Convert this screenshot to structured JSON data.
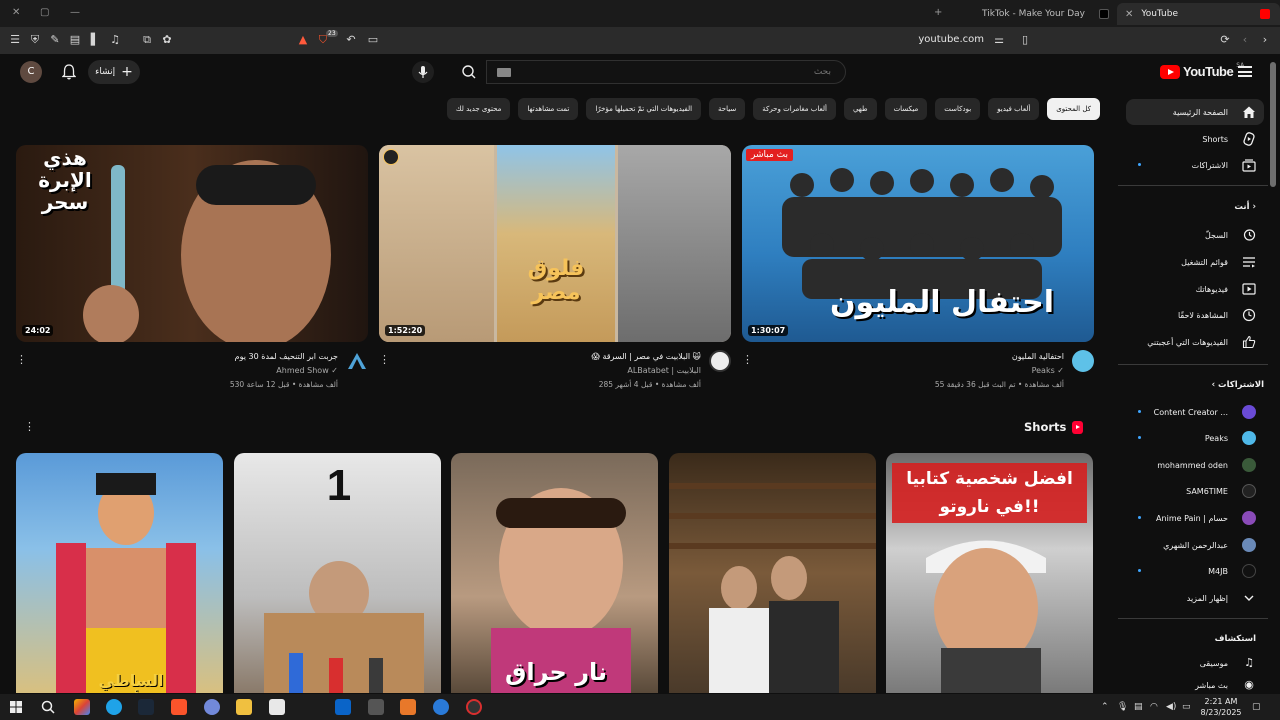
{
  "browser": {
    "tabs": [
      {
        "title": "TikTok - Make Your Day",
        "active": false
      },
      {
        "title": "YouTube",
        "active": true
      }
    ],
    "url": "youtube.com",
    "shield_count": "23"
  },
  "header": {
    "avatar_letter": "C",
    "create_label": "إنشاء",
    "search_placeholder": "بحث",
    "logo_text": "YouTube",
    "logo_region": "SA"
  },
  "chips": [
    {
      "label": "كل المحتوى",
      "active": true
    },
    {
      "label": "ألعاب فيديو"
    },
    {
      "label": "بودكاست"
    },
    {
      "label": "ميكسات"
    },
    {
      "label": "طهي"
    },
    {
      "label": "ألعاب مغامرات وحركة"
    },
    {
      "label": "سياحة"
    },
    {
      "label": "الفيديوهات التي تمّ تحميلها مؤخرًا"
    },
    {
      "label": "تمت مشاهدتها"
    },
    {
      "label": "محتوى جديد لك"
    }
  ],
  "videos": [
    {
      "title": "احتفالية المليون",
      "channel": "Peaks ✓",
      "stats": "55 ألف مشاهدة • تم البث قبل 36 دقيقة",
      "duration": "1:30:07",
      "thumb_text": "احتفال المليون",
      "live_badge": "بث مباشر"
    },
    {
      "title": "😱 البلابيت في مصر | السرقة 🙀",
      "channel": "ALBatabet | البلابيت",
      "stats": "285 ألف مشاهدة • قبل 4 أشهر",
      "duration": "1:52:20",
      "thumb_text": "فلوق مصر"
    },
    {
      "title": "جربت ابر التنحيف لمدة 30 يوم",
      "channel": "Ahmed Show ✓",
      "stats": "530 ألف مشاهدة • قبل 12 ساعة",
      "duration": "24:02",
      "thumb_text": "هذي الإبرة سحر"
    }
  ],
  "shorts": {
    "title": "Shorts",
    "items": [
      {
        "thumb_text": "افضل شخصية كتابيا في ناروتو!!"
      },
      {
        "thumb_text": ""
      },
      {
        "thumb_text": "نار حراق"
      },
      {
        "thumb_text": "1"
      },
      {
        "thumb_text": "الساطي الأول"
      }
    ]
  },
  "sidebar": {
    "main": [
      {
        "label": "الصفحة الرئيسية",
        "icon": "home-icon",
        "active": true
      },
      {
        "label": "Shorts",
        "icon": "shorts-icon"
      },
      {
        "label": "الاشتراكات",
        "icon": "subscriptions-icon",
        "dot": true
      }
    ],
    "you_heading": "أنت",
    "you": [
      {
        "label": "السجلّ",
        "icon": "history-icon"
      },
      {
        "label": "قوائم التشغيل",
        "icon": "playlists-icon"
      },
      {
        "label": "فيديوهاتك",
        "icon": "your-videos-icon"
      },
      {
        "label": "المشاهدة لاحقًا",
        "icon": "watch-later-icon"
      },
      {
        "label": "الفيديوهات التي أعجبتني",
        "icon": "liked-icon"
      }
    ],
    "subs_heading": "الاشتراكات",
    "subs": [
      {
        "label": "Content Creator ...",
        "color": "#6a4bd6",
        "dot": true
      },
      {
        "label": "Peaks",
        "color": "#4fb8e8",
        "dot": true
      },
      {
        "label": "mohammed oden",
        "color": "#3a5a3a"
      },
      {
        "label": "SAM6TIME",
        "color": "#222222"
      },
      {
        "label": "Anime Pain | حسام",
        "color": "#8a4bb8",
        "dot": true
      },
      {
        "label": "عبدالرحمن الشهري",
        "color": "#6a8ab8"
      },
      {
        "label": "M4JB",
        "color": "#111111",
        "dot": true
      },
      {
        "label": "إظهار المزيد",
        "icon": "chevron-down-icon"
      }
    ],
    "explore_heading": "استكشاف",
    "explore": [
      {
        "label": "موسيقى",
        "icon": "music-icon"
      },
      {
        "label": "بث مباشر",
        "icon": "live-icon"
      }
    ]
  },
  "taskbar": {
    "time": "2:21 AM",
    "date": "8/23/2025"
  }
}
